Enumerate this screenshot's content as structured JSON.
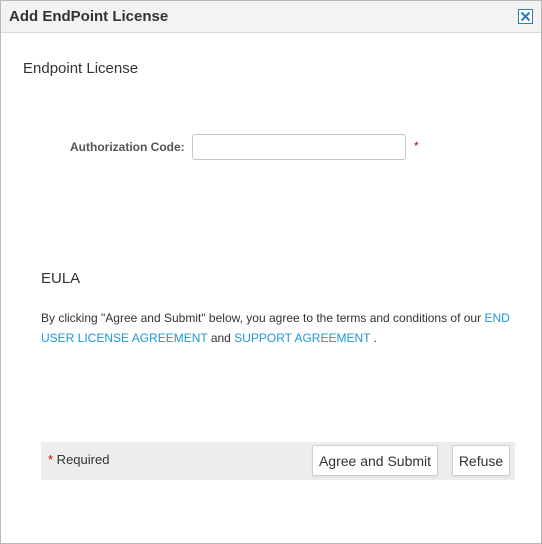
{
  "dialog": {
    "title": "Add EndPoint License",
    "close_icon": "close-icon"
  },
  "license": {
    "section_title": "Endpoint License",
    "auth_label": "Authorization Code:",
    "auth_value": "",
    "required_marker": "*"
  },
  "eula": {
    "section_title": "EULA",
    "text_before": " By clicking \"Agree and Submit\" below, you agree to the terms and conditions of our ",
    "link_end_user": "END USER LICENSE AGREEMENT",
    "text_and": " and ",
    "link_support": "SUPPORT AGREEMENT",
    "text_after": " ."
  },
  "footer": {
    "required_star": "*",
    "required_label": " Required",
    "agree_button": "Agree and Submit",
    "refuse_button": "Refuse"
  },
  "colors": {
    "link": "#1a9ad6",
    "required": "#cc0000",
    "close_border": "#2a7fb3"
  }
}
